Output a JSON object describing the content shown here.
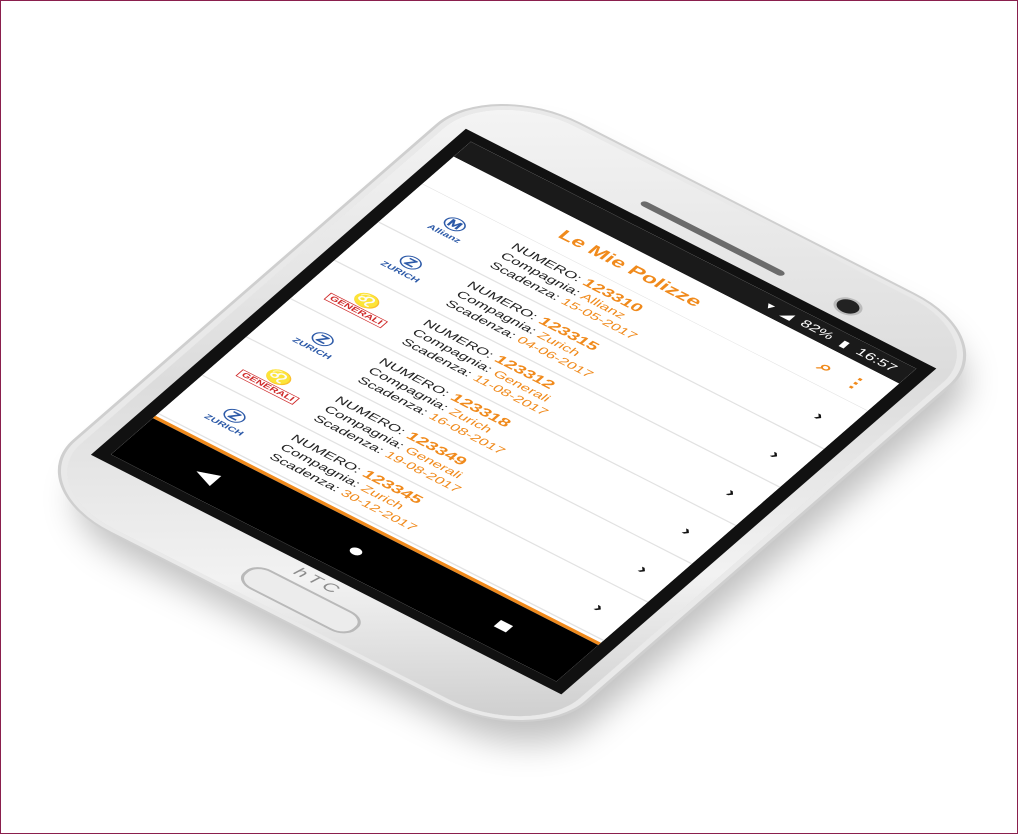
{
  "app": {
    "title": "Le Mie Polizze",
    "search_icon": "search-icon",
    "menu_icon": "more-vert-icon",
    "accent_color": "#f08a1c"
  },
  "statusbar": {
    "battery": "82%",
    "time": "16:57"
  },
  "labels": {
    "numero": "NUMERO:",
    "compagnia": "Compagnia:",
    "scadenza": "Scadenza:"
  },
  "policies": [
    {
      "logo": "Allianz",
      "numero": "123310",
      "compagnia": "Allianz",
      "scadenza": "15-05-2017"
    },
    {
      "logo": "ZURICH",
      "numero": "123315",
      "compagnia": "Zurich",
      "scadenza": "04-06-2017"
    },
    {
      "logo": "GENERALI",
      "numero": "123312",
      "compagnia": "Generali",
      "scadenza": "11-08-2017"
    },
    {
      "logo": "ZURICH",
      "numero": "123318",
      "compagnia": "Zurich",
      "scadenza": "16-08-2017"
    },
    {
      "logo": "GENERALI",
      "numero": "123349",
      "compagnia": "Generali",
      "scadenza": "19-08-2017"
    },
    {
      "logo": "ZURICH",
      "numero": "123345",
      "compagnia": "Zurich",
      "scadenza": "30-12-2017"
    }
  ],
  "device": {
    "brand": "hTC"
  },
  "navbar": {
    "back": "◀",
    "home": "●",
    "recents": "■"
  }
}
